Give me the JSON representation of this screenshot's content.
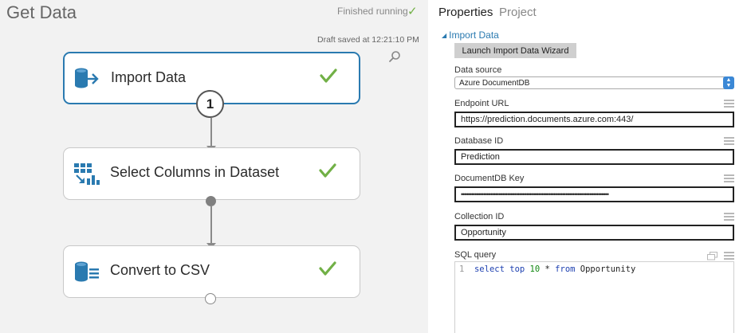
{
  "experiment": {
    "title": "Get Data",
    "status_text": "Finished running",
    "draft_text": "Draft saved at 12:21:10 PM"
  },
  "modules": [
    {
      "label": "Import Data",
      "status": "finished",
      "selected": true,
      "icon": "import-data-icon"
    },
    {
      "label": "Select Columns in Dataset",
      "status": "finished",
      "selected": false,
      "icon": "select-columns-icon"
    },
    {
      "label": "Convert to CSV",
      "status": "finished",
      "selected": false,
      "icon": "convert-csv-icon"
    }
  ],
  "port_badge": "1",
  "panel": {
    "tabs": [
      "Properties",
      "Project"
    ],
    "section_title": "Import Data",
    "wizard_button": "Launch Import Data Wizard",
    "fields": {
      "data_source": {
        "label": "Data source",
        "value": "Azure DocumentDB"
      },
      "endpoint_url": {
        "label": "Endpoint URL",
        "value": "https://prediction.documents.azure.com:443/"
      },
      "database_id": {
        "label": "Database ID",
        "value": "Prediction"
      },
      "documentdb_key": {
        "label": "DocumentDB Key",
        "value": "••••••••••••••••••••••••••••••••••••••••••••••••••••••••••••••••••••••••••••••••••••••"
      },
      "collection_id": {
        "label": "Collection ID",
        "value": "Opportunity"
      },
      "sql_query": {
        "label": "SQL query",
        "line_number": "1"
      }
    }
  },
  "colors": {
    "accent": "#2a7ab0",
    "success": "#71b046",
    "module_icon": "#2a7ab0"
  }
}
